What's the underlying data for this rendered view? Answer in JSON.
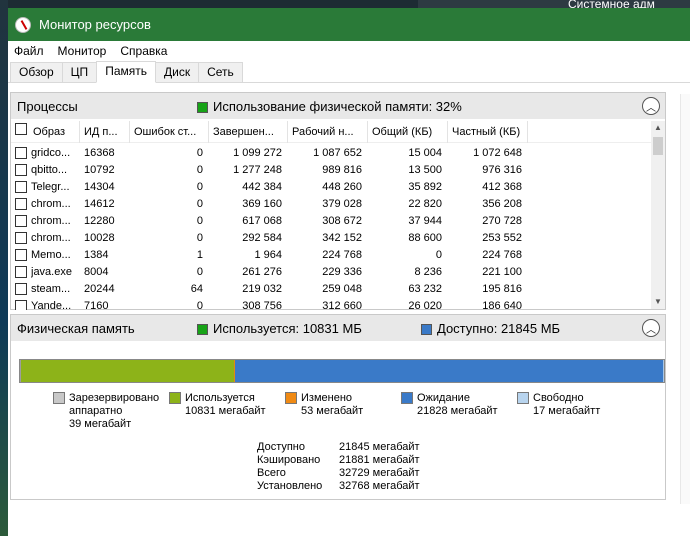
{
  "window": {
    "title": "Монитор ресурсов"
  },
  "desktop": {
    "right_text": "Системное адм"
  },
  "menu": [
    "Файл",
    "Монитор",
    "Справка"
  ],
  "tabs": [
    {
      "label": "Обзор",
      "active": false
    },
    {
      "label": "ЦП",
      "active": false
    },
    {
      "label": "Память",
      "active": true
    },
    {
      "label": "Диск",
      "active": false
    },
    {
      "label": "Сеть",
      "active": false
    }
  ],
  "processes": {
    "title": "Процессы",
    "usage_text": "Использование физической памяти: 32%",
    "usage_color": "#17a317",
    "columns": [
      "Образ",
      "ИД п...",
      "Ошибок ст...",
      "Завершен...",
      "Рабочий н...",
      "Общий (КБ)",
      "Частный (КБ)"
    ],
    "rows": [
      [
        "gridco...",
        "16368",
        "0",
        "1 099 272",
        "1 087 652",
        "15 004",
        "1 072 648"
      ],
      [
        "qbitto...",
        "10792",
        "0",
        "1 277 248",
        "989 816",
        "13 500",
        "976 316"
      ],
      [
        "Telegr...",
        "14304",
        "0",
        "442 384",
        "448 260",
        "35 892",
        "412 368"
      ],
      [
        "chrom...",
        "14612",
        "0",
        "369 160",
        "379 028",
        "22 820",
        "356 208"
      ],
      [
        "chrom...",
        "12280",
        "0",
        "617 068",
        "308 672",
        "37 944",
        "270 728"
      ],
      [
        "chrom...",
        "10028",
        "0",
        "292 584",
        "342 152",
        "88 600",
        "253 552"
      ],
      [
        "Memo...",
        "1384",
        "1",
        "1 964",
        "224 768",
        "0",
        "224 768"
      ],
      [
        "java.exe",
        "8004",
        "0",
        "261 276",
        "229 336",
        "8 236",
        "221 100"
      ],
      [
        "steam...",
        "20244",
        "64",
        "219 032",
        "259 048",
        "63 232",
        "195 816"
      ],
      [
        "Yande...",
        "7160",
        "0",
        "308 756",
        "312 660",
        "26 020",
        "186 640"
      ]
    ]
  },
  "memory": {
    "title": "Физическая память",
    "in_use_text": "Используется: 10831 МБ",
    "available_text": "Доступно: 21845 МБ",
    "bar": [
      {
        "key": "reserved",
        "fraction": 0.0012,
        "color": "#9e9e9e"
      },
      {
        "key": "in_use",
        "fraction": 0.331,
        "color": "#8db319"
      },
      {
        "key": "modified",
        "fraction": 0.0016,
        "color": "#e38a14"
      },
      {
        "key": "standby",
        "fraction": 0.667,
        "color": "#3a7ac8"
      },
      {
        "key": "free",
        "fraction": 0.0005,
        "color": "#a7c7e8"
      }
    ],
    "legend": [
      {
        "label": "Зарезервировано",
        "label2": "аппаратно",
        "value": "39 мегабайт",
        "color": "#c8c8c8"
      },
      {
        "label": "Используется",
        "value": "10831 мегабайт",
        "color": "#8db319"
      },
      {
        "label": "Изменено",
        "value": "53 мегабайт",
        "color": "#f08a14"
      },
      {
        "label": "Ожидание",
        "value": "21828 мегабайт",
        "color": "#3a7ac8"
      },
      {
        "label": "Свободно",
        "value": "17 мегабайтт",
        "color": "#b8d4ee"
      }
    ],
    "stats": [
      {
        "label": "Доступно",
        "value": "21845 мегабайт"
      },
      {
        "label": "Кэшировано",
        "value": "21881 мегабайт"
      },
      {
        "label": "Всего",
        "value": "32729 мегабайт"
      },
      {
        "label": "Установлено",
        "value": "32768 мегабайт"
      }
    ]
  }
}
